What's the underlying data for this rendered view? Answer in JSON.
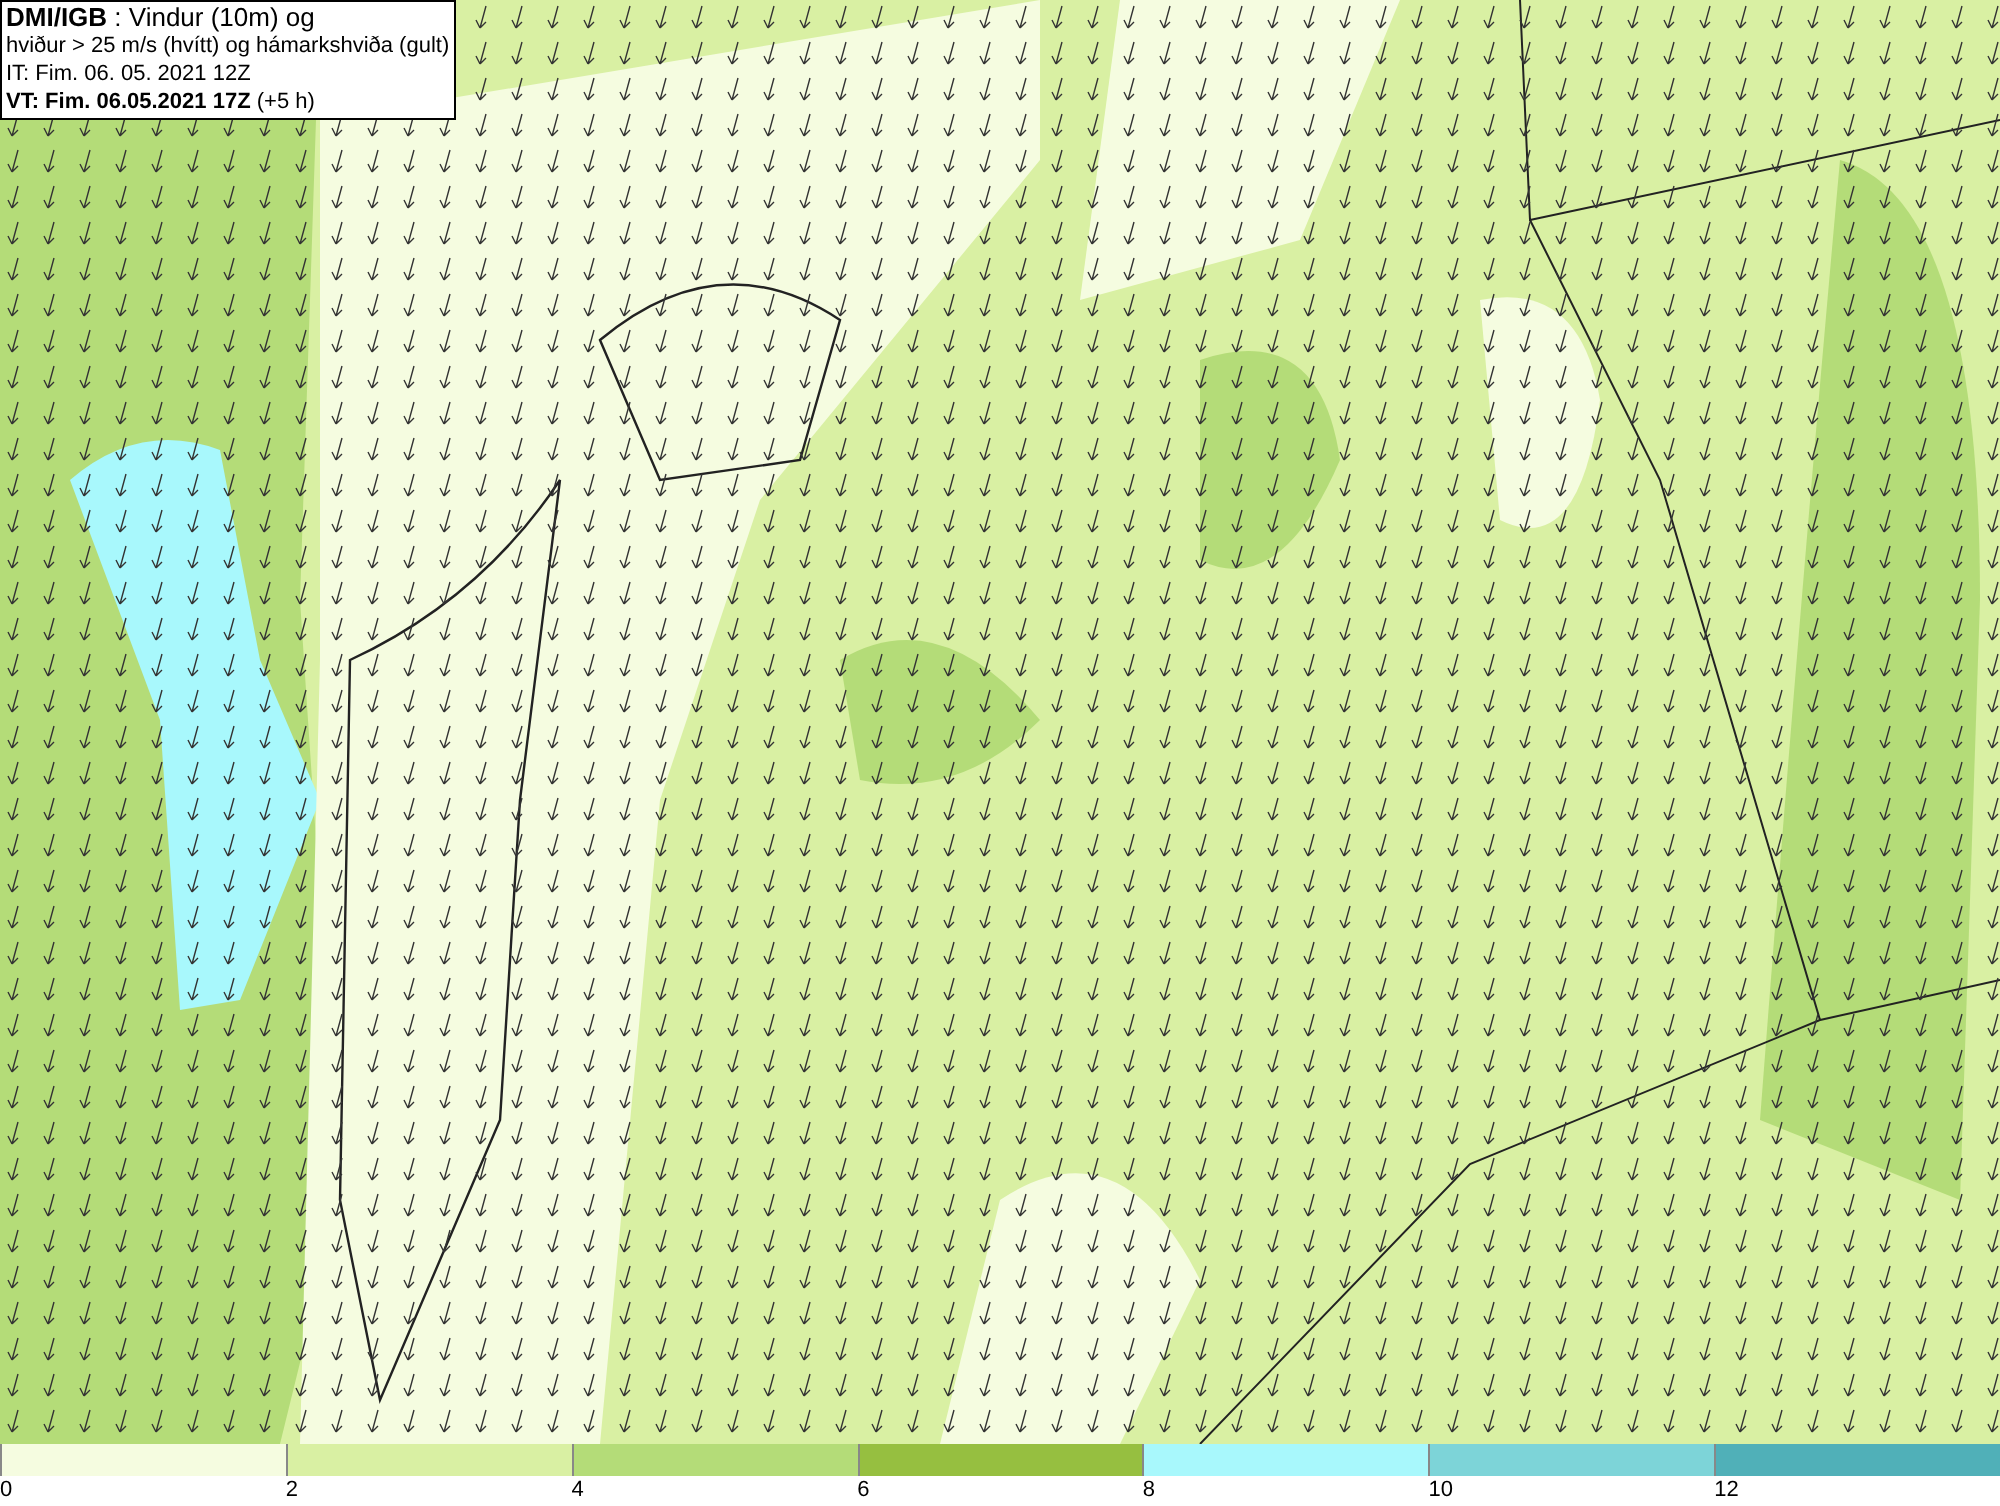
{
  "info_box": {
    "lines": [
      "**DMI/IGB** : Vindur (10m) og",
      "hviður > 25 m/s (hvítt) og hámarkshviða (gult)",
      "IT: Fim. 06. 05. 2021 12Z",
      "**VT: Fim. 06.05.2021 17Z** (+5 h)"
    ]
  },
  "colorbar": {
    "bins": [
      {
        "label": "0",
        "color": "#f5fce0"
      },
      {
        "label": "2",
        "color": "#d9f0a3"
      },
      {
        "label": "4",
        "color": "#b4dc78"
      },
      {
        "label": "6",
        "color": "#96bf40"
      },
      {
        "label": "8",
        "color": "#a8f8fc"
      },
      {
        "label": "10",
        "color": "#7dd4d8"
      },
      {
        "label": "12",
        "color": "#50b0b8"
      }
    ]
  }
}
